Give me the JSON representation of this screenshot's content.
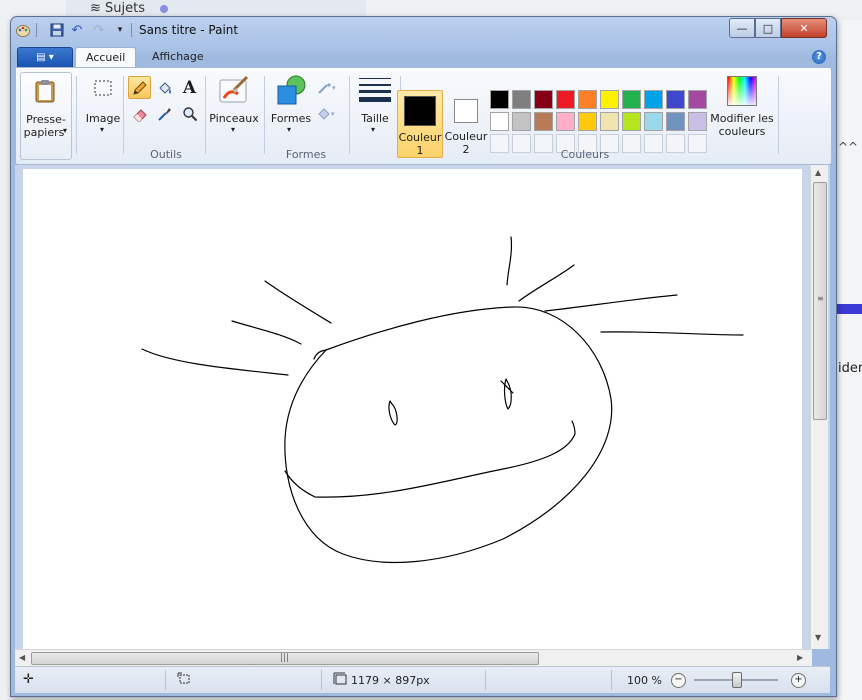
{
  "background": {
    "sidebar_title": "Sujets",
    "side_text": "ider",
    "side_arrows": "^^"
  },
  "window": {
    "title": "Sans titre - Paint",
    "controls": {
      "minimize": "—",
      "maximize": "□",
      "close": "✕"
    }
  },
  "ribbon": {
    "app_menu_icon": "paint-menu-icon",
    "tabs": [
      {
        "label": "Accueil",
        "active": true
      },
      {
        "label": "Affichage",
        "active": false
      }
    ],
    "groups": {
      "clipboard": {
        "label": "Presse-\npapiers",
        "label_line1": "Presse-",
        "label_line2": "papiers"
      },
      "image": {
        "label": "Image"
      },
      "tools": {
        "label": "Outils"
      },
      "brushes": {
        "label": "Pinceaux"
      },
      "shapes": {
        "button": "Formes",
        "label": "Formes"
      },
      "size": {
        "label": "Taille"
      },
      "color1": {
        "line1": "Couleur",
        "line2": "1",
        "value": "#000000"
      },
      "color2": {
        "line1": "Couleur",
        "line2": "2",
        "value": "#ffffff"
      },
      "colors": {
        "label": "Couleurs"
      },
      "edit_colors": {
        "line1": "Modifier les",
        "line2": "couleurs"
      }
    },
    "palette_row1": [
      "#000000",
      "#7f7f7f",
      "#880015",
      "#ed1c24",
      "#ff7f27",
      "#fff200",
      "#22b14c",
      "#00a2e8",
      "#3f48cc",
      "#a349a4"
    ],
    "palette_row2": [
      "#ffffff",
      "#c3c3c3",
      "#b97a57",
      "#ffaec9",
      "#ffc90e",
      "#efe4b0",
      "#b5e61d",
      "#99d9ea",
      "#7092be",
      "#c8bfe7"
    ],
    "palette_row3_count": 10
  },
  "status": {
    "dimensions": "1179 × 897px",
    "zoom": "100 %"
  }
}
